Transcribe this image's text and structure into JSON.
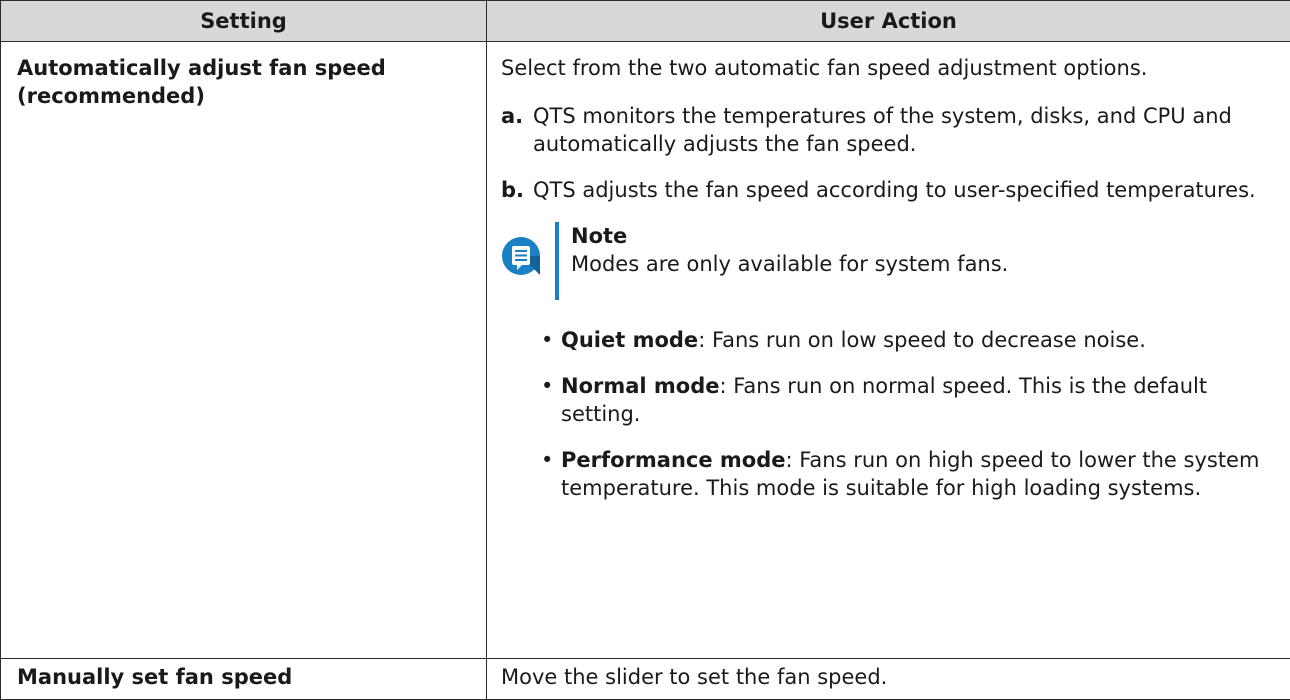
{
  "table": {
    "headers": [
      "Setting",
      "User Action"
    ],
    "row1": {
      "setting": "Automatically adjust fan speed (recommended)",
      "intro": "Select from the two automatic fan speed adjustment options.",
      "steps": [
        {
          "letter": "a.",
          "text": "QTS monitors the temperatures of the system, disks, and CPU and automatically adjusts the fan speed."
        },
        {
          "letter": "b.",
          "text": "QTS adjusts the fan speed according to user-specified temperatures."
        }
      ],
      "note": {
        "icon": "note-icon",
        "title": "Note",
        "text": "Modes are only available for system fans."
      },
      "modes": [
        {
          "bullet": "•",
          "name": "Quiet mode",
          "desc": ": Fans run on low speed to decrease noise."
        },
        {
          "bullet": "•",
          "name": "Normal mode",
          "desc": ": Fans run on normal speed. This is the default setting."
        },
        {
          "bullet": "•",
          "name": "Performance mode",
          "desc": ": Fans run on high speed to lower the system temperature. This mode is suitable for high loading systems."
        }
      ]
    },
    "row2": {
      "setting": "Manually set fan speed",
      "action": "Move the slider to set the fan speed."
    }
  },
  "colors": {
    "header_bg": "#d8d8d8",
    "note_accent": "#1b7fc4"
  }
}
